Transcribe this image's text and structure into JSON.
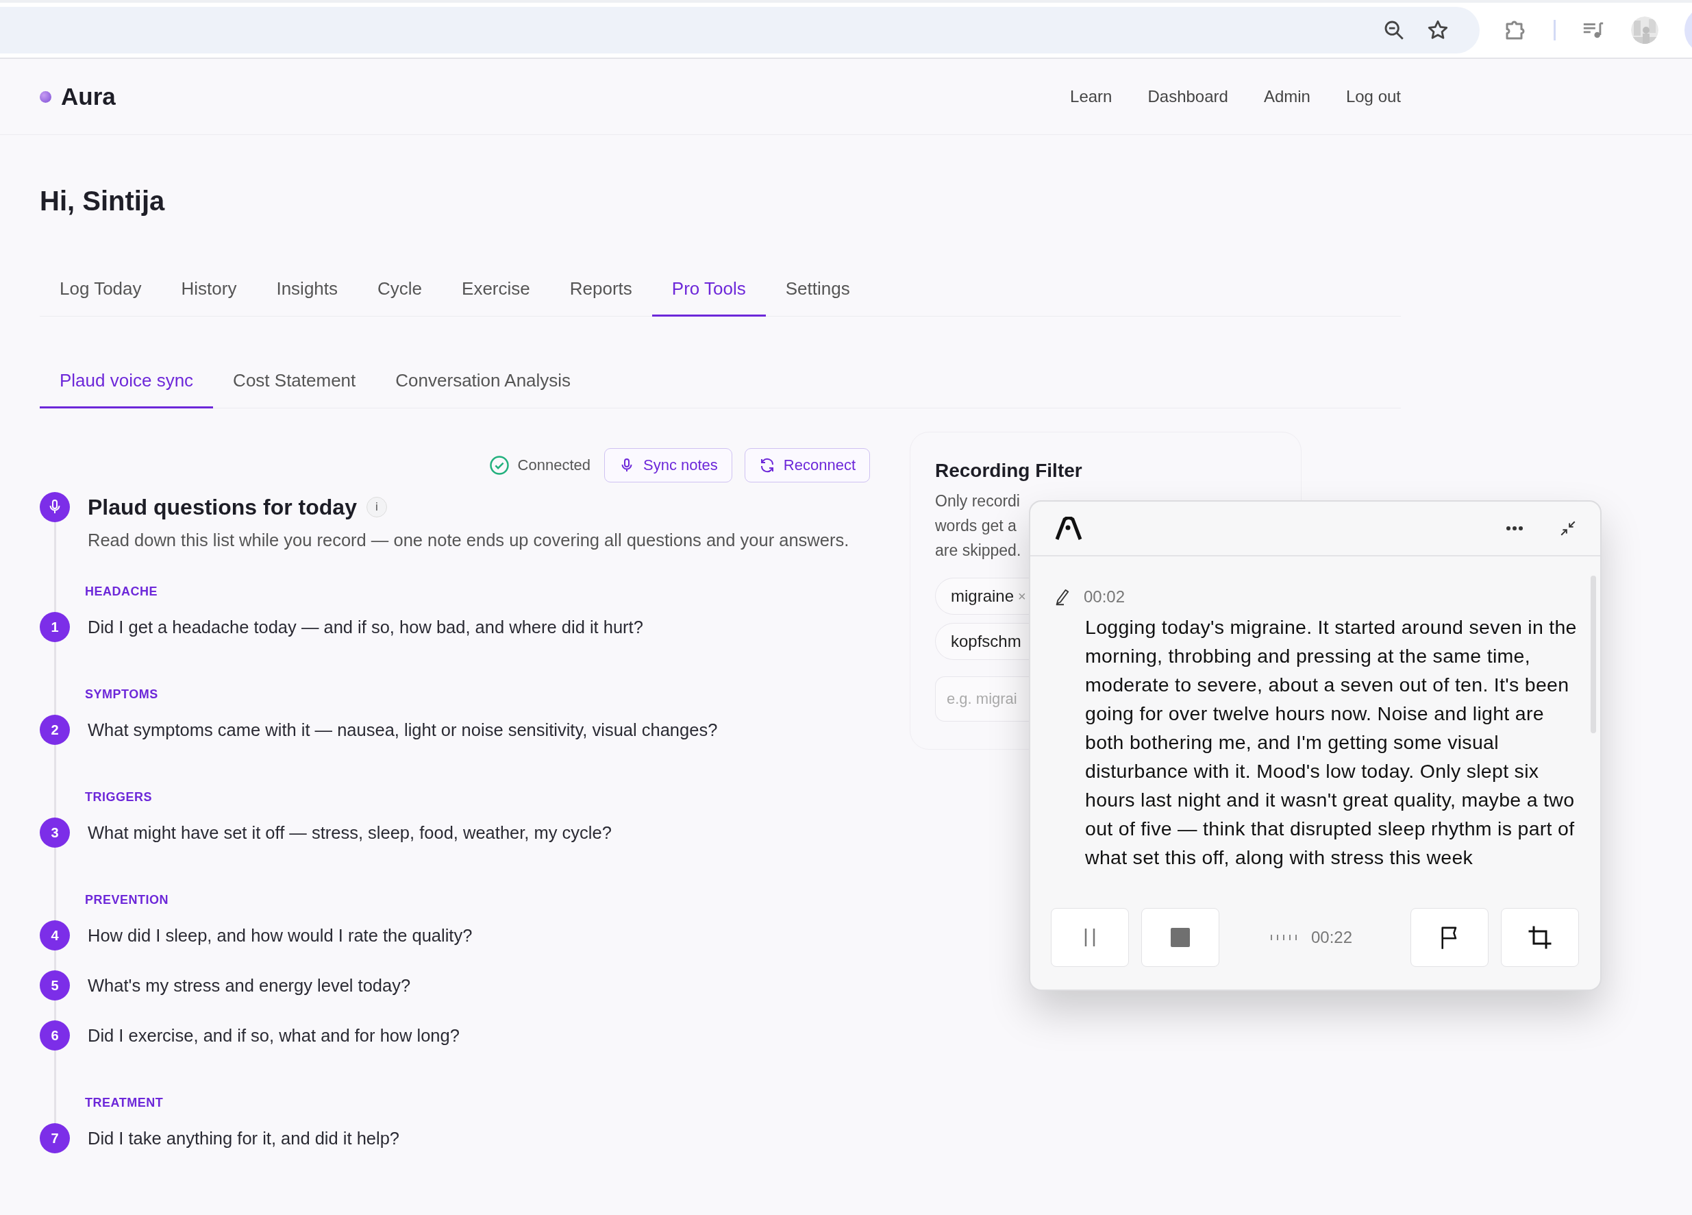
{
  "app": {
    "brand": "Aura",
    "nav": [
      {
        "label": "Learn"
      },
      {
        "label": "Dashboard"
      },
      {
        "label": "Admin"
      },
      {
        "label": "Log out"
      }
    ]
  },
  "greeting": "Hi, Sintija",
  "tabs": [
    {
      "label": "Log Today",
      "selected": false
    },
    {
      "label": "History",
      "selected": false
    },
    {
      "label": "Insights",
      "selected": false
    },
    {
      "label": "Cycle",
      "selected": false
    },
    {
      "label": "Exercise",
      "selected": false
    },
    {
      "label": "Reports",
      "selected": false
    },
    {
      "label": "Pro Tools",
      "selected": true
    },
    {
      "label": "Settings",
      "selected": false
    }
  ],
  "subtabs": [
    {
      "label": "Plaud voice sync",
      "selected": true
    },
    {
      "label": "Cost Statement",
      "selected": false
    },
    {
      "label": "Conversation Analysis",
      "selected": false
    }
  ],
  "status": {
    "label": "Connected",
    "connected": true
  },
  "actions": [
    {
      "kind": "mic",
      "label": "Sync notes"
    },
    {
      "kind": "refresh",
      "label": "Reconnect"
    }
  ],
  "questions": {
    "title": "Plaud questions for today",
    "info": "i",
    "description": "Read down this list while you record — one note ends up covering all questions and your answers.",
    "groups": [
      {
        "label": "HEADACHE",
        "items": [
          {
            "number": "1",
            "text": "Did I get a headache today — and if so, how bad, and where did it hurt?"
          }
        ]
      },
      {
        "label": "SYMPTOMS",
        "items": [
          {
            "number": "2",
            "text": "What symptoms came with it — nausea, light or noise sensitivity, visual changes?"
          }
        ]
      },
      {
        "label": "TRIGGERS",
        "items": [
          {
            "number": "3",
            "text": "What might have set it off — stress, sleep, food, weather, my cycle?"
          }
        ]
      },
      {
        "label": "PREVENTION",
        "items": [
          {
            "number": "4",
            "text": "How did I sleep, and how would I rate the quality?"
          },
          {
            "number": "5",
            "text": "What's my stress and energy level today?"
          },
          {
            "number": "6",
            "text": "Did I exercise, and if so, what and for how long?"
          }
        ]
      },
      {
        "label": "TREATMENT",
        "items": [
          {
            "number": "7",
            "text": "Did I take anything for it, and did it help?"
          }
        ]
      }
    ]
  },
  "filter": {
    "title": "Recording Filter",
    "description_lines": [
      "Only recordi",
      "words get a",
      "are skipped."
    ],
    "chips": [
      {
        "label": "migraine",
        "remove": "×"
      },
      {
        "label": "kopfschm"
      }
    ],
    "input": {
      "placeholder": "e.g. migrai"
    }
  },
  "popup": {
    "entry": {
      "time": "00:02",
      "text": "Logging today's migraine. It started around seven in the morning, throbbing and pressing at the same time, moderate to severe, about a seven out of ten. It's been going for over twelve hours now. Noise and light are both bothering me, and I'm getting some visual disturbance with it. Mood's low today. Only slept six hours last night and it wasn't great quality, maybe a two out of five — think that disrupted sleep rhythm is part of what set this off, along with stress this week"
    },
    "timer": "00:22"
  }
}
